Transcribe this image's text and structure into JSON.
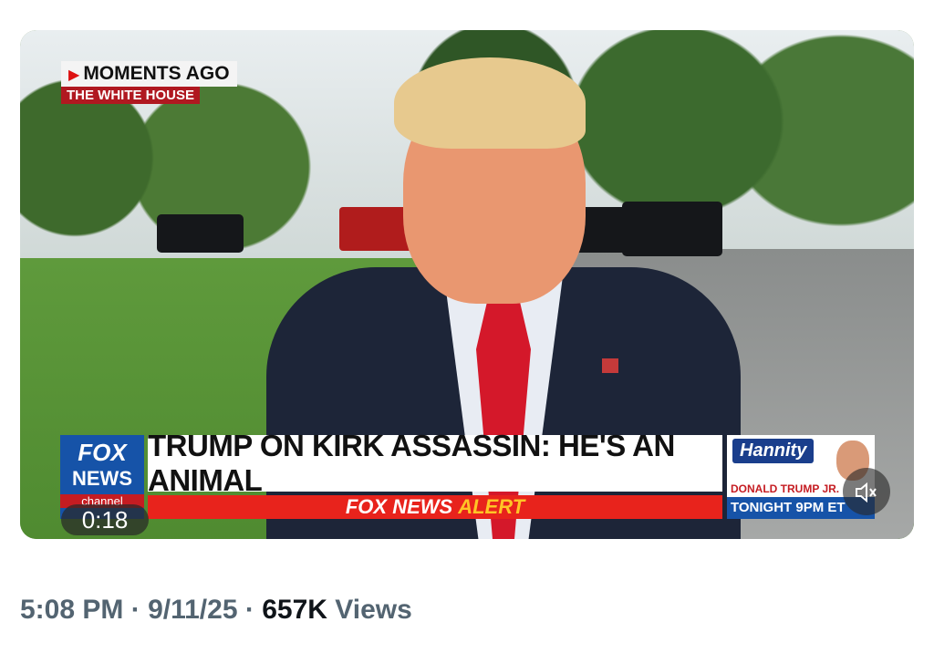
{
  "video": {
    "overlay": {
      "moments_label": "MOMENTS AGO",
      "location_label": "THE WHITE HOUSE"
    },
    "lower_third": {
      "network_logo_line1": "FOX",
      "network_logo_line2": "NEWS",
      "network_logo_line3": "channel",
      "headline": "TRUMP ON KIRK ASSASSIN: HE'S AN ANIMAL",
      "alert_part1": "FOX NEWS",
      "alert_part2": "ALERT"
    },
    "promo": {
      "show_name": "Hannity",
      "guest": "DONALD TRUMP JR.",
      "airtime": "TONIGHT 9PM ET"
    },
    "timer": "0:18",
    "volume_icon": "speaker-muted-icon"
  },
  "meta": {
    "time": "5:08 PM",
    "separator": "·",
    "date": "9/11/25",
    "views_count": "657K",
    "views_label": "Views"
  }
}
